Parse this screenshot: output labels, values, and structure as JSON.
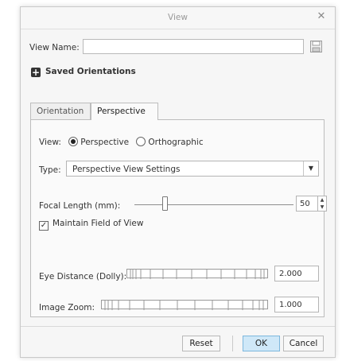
{
  "dialog": {
    "title": "View",
    "close_glyph": "✕"
  },
  "view_name": {
    "label": "View Name:",
    "value": "",
    "save_icon": "floppy-disk-icon"
  },
  "saved_orientations": {
    "label": "Saved Orientations",
    "expand_glyph": "+"
  },
  "tabs": [
    {
      "label": "Orientation",
      "active": false
    },
    {
      "label": "Perspective",
      "active": true
    }
  ],
  "perspective": {
    "view_label": "View:",
    "view_options": [
      {
        "label": "Perspective",
        "selected": true
      },
      {
        "label": "Orthographic",
        "selected": false
      }
    ],
    "type_label": "Type:",
    "type_value": "Perspective View Settings",
    "focal_length_label": "Focal Length (mm):",
    "focal_length_value": "50",
    "maintain_fov_label": "Maintain Field of View",
    "maintain_fov_checked": true,
    "eye_distance_label": "Eye Distance (Dolly):",
    "eye_distance_value": "2.000",
    "image_zoom_label": "Image Zoom:",
    "image_zoom_value": "1.000"
  },
  "footer": {
    "reset_label": "Reset",
    "ok_label": "OK",
    "cancel_label": "Cancel"
  }
}
